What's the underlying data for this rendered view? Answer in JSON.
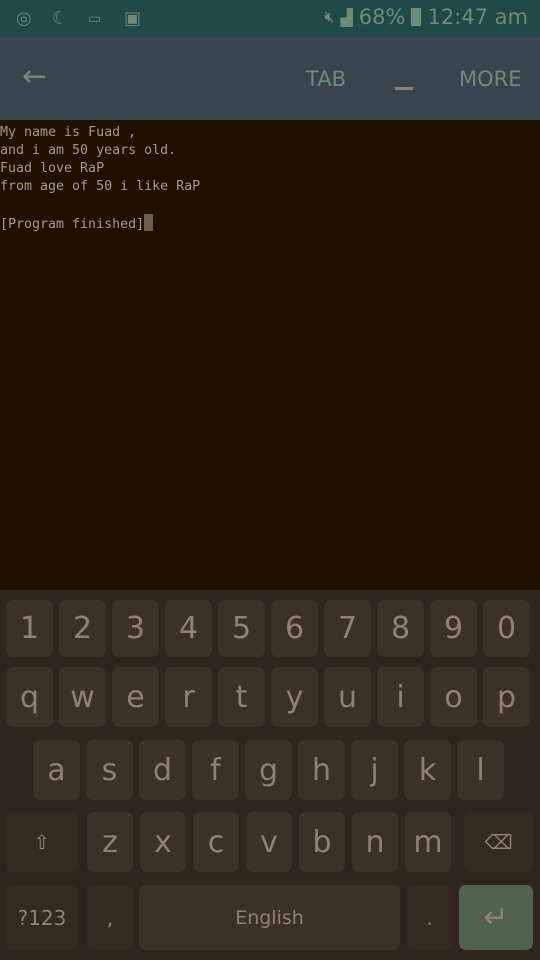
{
  "status_bar": {
    "battery": "68%",
    "time": "12:47 am",
    "icons": [
      "music-icon",
      "night-mode-icon",
      "keyboard-icon",
      "image-icon",
      "mute-icon",
      "signal-icon",
      "battery-icon"
    ]
  },
  "toolbar": {
    "back_icon": "arrow-left-icon",
    "tab_label": "TAB",
    "underscore_label": "_",
    "more_label": "MORE"
  },
  "terminal": {
    "lines": [
      "My name is Fuad ,",
      "and i am 50 years old.",
      "Fuad love RaP",
      "from age of 50 i like RaP",
      "",
      "[Program finished]"
    ]
  },
  "keyboard": {
    "numbers": [
      "1",
      "2",
      "3",
      "4",
      "5",
      "6",
      "7",
      "8",
      "9",
      "0"
    ],
    "row1": [
      "q",
      "w",
      "e",
      "r",
      "t",
      "y",
      "u",
      "i",
      "o",
      "p"
    ],
    "row2": [
      "a",
      "s",
      "d",
      "f",
      "g",
      "h",
      "j",
      "k",
      "l"
    ],
    "row3": [
      "z",
      "x",
      "c",
      "v",
      "b",
      "n",
      "m"
    ],
    "symbols_label": "?123",
    "comma": ",",
    "space_label": "English",
    "period": ".",
    "shift_icon": "shift-icon",
    "backspace_icon": "backspace-icon",
    "enter_icon": "enter-icon"
  },
  "colors": {
    "status_bar": "#1f4a45",
    "toolbar": "#39454e",
    "terminal_bg": "#1f1000",
    "keyboard_bg": "#2e261c",
    "enter_key": "#51624f"
  }
}
